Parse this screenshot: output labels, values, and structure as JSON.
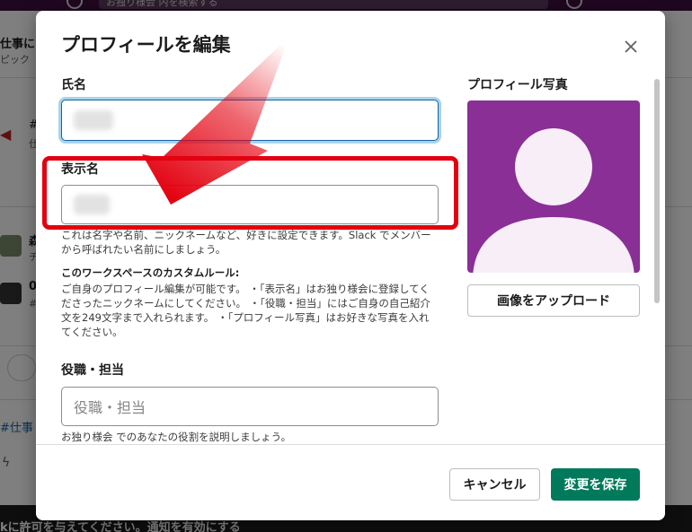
{
  "background": {
    "search_placeholder": "お独り様会 内を検索する",
    "channel_title": "仕事に",
    "channel_sub": "ピック",
    "channel_hash_1": "#",
    "channel_mark_1": "仕",
    "user_name_1": "森",
    "user_msg_1": "チ",
    "user_name_2": "0",
    "user_msg_2": "#",
    "channel_hash_2": "#仕事",
    "banner_text": "kに許可を与えてください。",
    "banner_link": "通知を有効にする"
  },
  "modal": {
    "title": "プロフィールを編集",
    "full_name": {
      "label": "氏名",
      "value": ""
    },
    "display_name": {
      "label": "表示名",
      "value": "",
      "help": "これは名字や名前、ニックネームなど、好きに設定できます。Slack でメンバーから呼ばれたい名前にしましょう。"
    },
    "custom_rule": {
      "title": "このワークスペースのカスタムルール:",
      "body": "ご自身のプロフィール編集が可能です。 ・「表示名」はお独り様会に登録してくださったニックネームにしてください。 ・「役職・担当」にはご自身の自己紹介文を249文字まで入れられます。 ・「プロフィール写真」はお好きな写真を入れてください。"
    },
    "title_field": {
      "label": "役職・担当",
      "placeholder": "役職・担当",
      "help": "お独り様会 でのあなたの役割を説明しましょう。"
    },
    "photo": {
      "label": "プロフィール写真",
      "upload_label": "画像をアップロード",
      "bg_color": "#8a2f95"
    },
    "footer": {
      "cancel_label": "キャンセル",
      "save_label": "変更を保存"
    }
  },
  "annotation": {
    "color": "#e3000f"
  }
}
